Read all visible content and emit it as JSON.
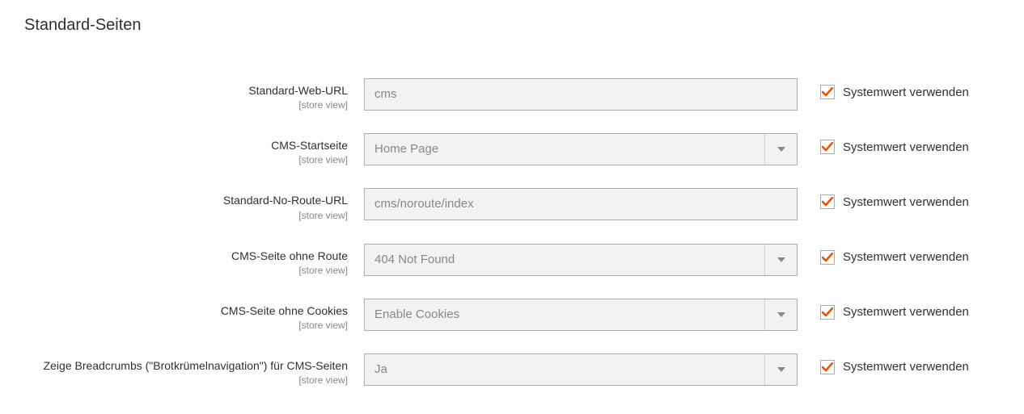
{
  "section_title": "Standard-Seiten",
  "scope_label": "[store view]",
  "use_default_label": "Systemwert verwenden",
  "fields": [
    {
      "label": "Standard-Web-URL",
      "type": "text",
      "value": "cms",
      "checked": true
    },
    {
      "label": "CMS-Startseite",
      "type": "select",
      "value": "Home Page",
      "checked": true
    },
    {
      "label": "Standard-No-Route-URL",
      "type": "text",
      "value": "cms/noroute/index",
      "checked": true
    },
    {
      "label": "CMS-Seite ohne Route",
      "type": "select",
      "value": "404 Not Found",
      "checked": true
    },
    {
      "label": "CMS-Seite ohne Cookies",
      "type": "select",
      "value": "Enable Cookies",
      "checked": true
    },
    {
      "label": "Zeige Breadcrumbs (\"Brotkrümelnavigation\") für CMS-Seiten",
      "type": "select",
      "value": "Ja",
      "checked": true
    }
  ]
}
